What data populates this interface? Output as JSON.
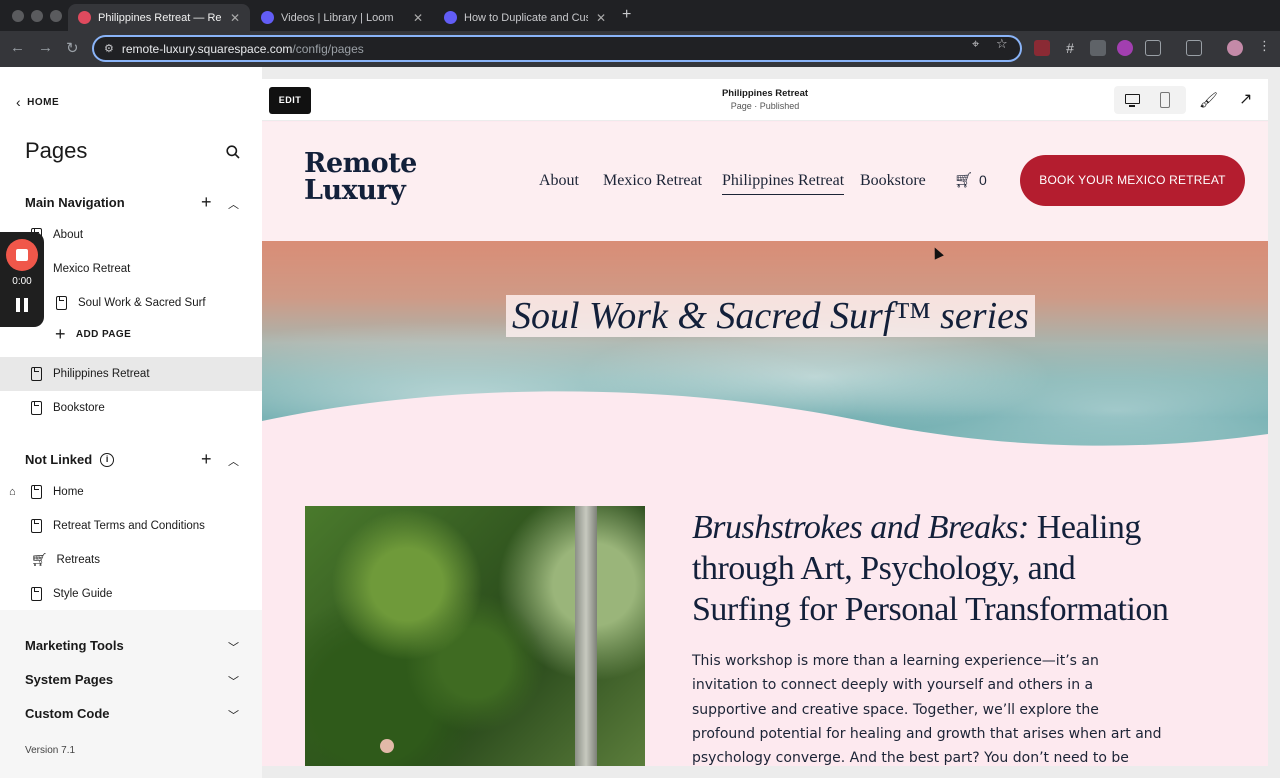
{
  "browser": {
    "tabs": [
      {
        "title": "Philippines Retreat — Remote Luxury",
        "active": true,
        "favicon_color": "#e04a5e"
      },
      {
        "title": "Videos | Library | Loom",
        "active": false,
        "favicon_color": "#625df5"
      },
      {
        "title": "How to Duplicate and Customize",
        "active": false,
        "favicon_color": "#625df5"
      }
    ],
    "url_host": "remote-luxury.squarespace.com",
    "url_path": "/config/pages"
  },
  "sidebar": {
    "back_label": "HOME",
    "title": "Pages",
    "main_nav": {
      "label": "Main Navigation",
      "items": [
        {
          "label": "About"
        },
        {
          "label": "Mexico Retreat"
        },
        {
          "label": "Soul Work & Sacred Surf"
        },
        {
          "label": "Philippines Retreat"
        },
        {
          "label": "Bookstore"
        }
      ],
      "add_page": "ADD PAGE"
    },
    "not_linked": {
      "label": "Not Linked",
      "items": [
        {
          "label": "Home"
        },
        {
          "label": "Retreat Terms and Conditions"
        },
        {
          "label": "Retreats"
        },
        {
          "label": "Style Guide"
        }
      ]
    },
    "sections": [
      {
        "label": "Marketing Tools"
      },
      {
        "label": "System Pages"
      },
      {
        "label": "Custom Code"
      }
    ],
    "version": "Version 7.1"
  },
  "recorder": {
    "time": "0:00"
  },
  "preview": {
    "edit_label": "EDIT",
    "page_title": "Philippines Retreat",
    "page_status": "Page · Published",
    "logo_line1": "Remote",
    "logo_line2": "Luxury",
    "nav": [
      "About",
      "Mexico Retreat",
      "Philippines Retreat",
      "Bookstore"
    ],
    "cart_count": "0",
    "book_button": "BOOK YOUR MEXICO RETREAT",
    "hero_title": "Soul Work & Sacred Surf™ series",
    "article_title_em": "Brushstrokes and Breaks:",
    "article_title_rest": " Healing through Art, Psychology, and Surfing for Personal Transformation",
    "article_body": "This workshop is more than a learning experience—it’s an invitation to connect deeply with yourself and others in a supportive and creative space. Together, we’ll explore the profound potential for healing and growth that arises when art and psychology converge. And the best part? You don’t need to be “good” at art—there’s no right or wrong"
  },
  "colors": {
    "brand_navy": "#13203a",
    "book_button_red": "#b41d2f",
    "page_pink": "#fde9ef",
    "omnibox_focus": "#8ab4f8"
  }
}
